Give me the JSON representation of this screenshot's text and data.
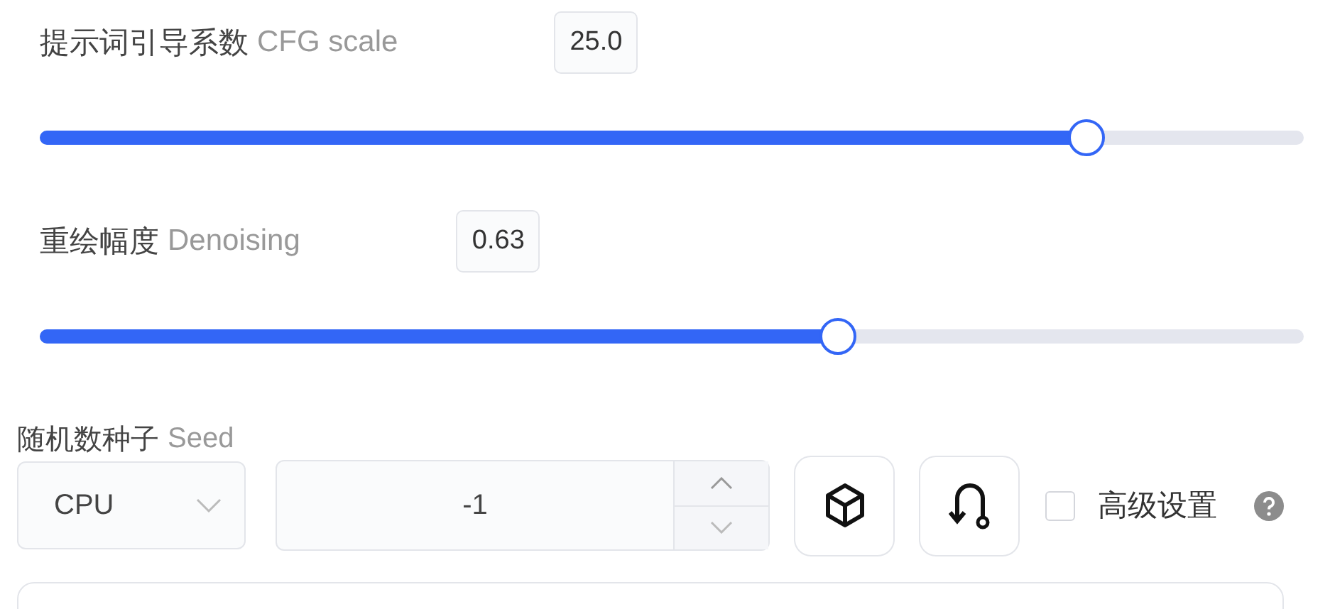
{
  "sliders": [
    {
      "label": "提示词引导系数",
      "label_en": "CFG scale",
      "value": "25.0",
      "level": 0.828
    },
    {
      "label": "重绘幅度",
      "label_en": "Denoising",
      "value": "0.63",
      "level": 0.631
    }
  ],
  "seed": {
    "label": "随机数种子",
    "label_en": "Seed",
    "device": "CPU",
    "value": "-1"
  },
  "advanced": {
    "label": "高级设置",
    "checked": false
  }
}
